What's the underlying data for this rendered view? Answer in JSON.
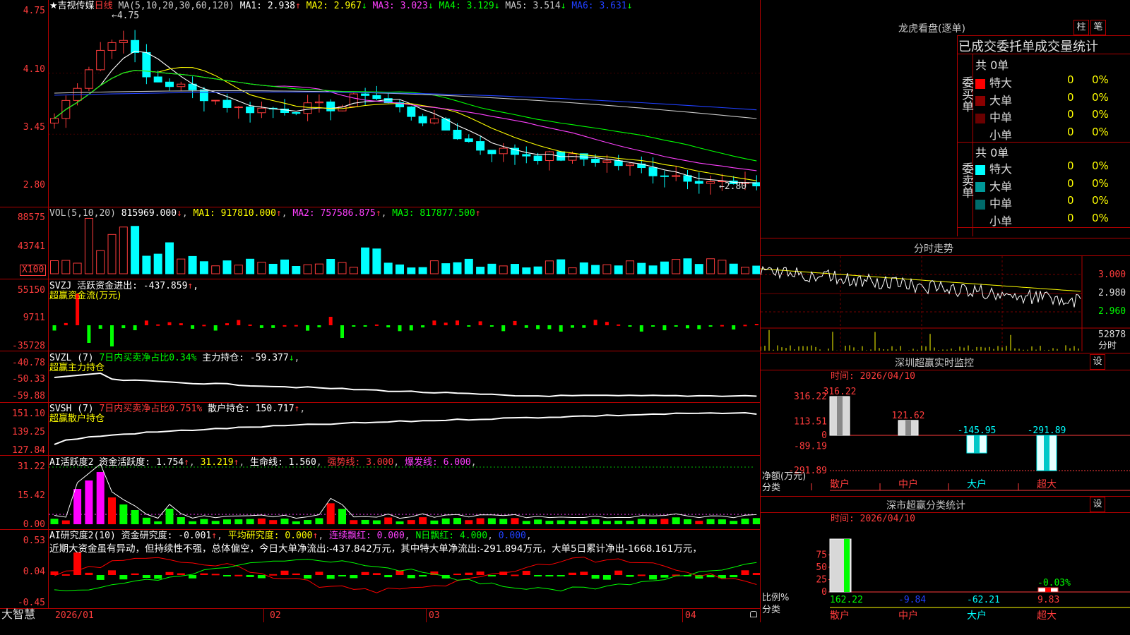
{
  "main": {
    "title": "★吉视传媒",
    "period": "日线",
    "ma_header": "MA(5,10,20,30,60,120)",
    "ma": [
      {
        "label": "MA1: 2.938",
        "arrow": "↑",
        "color": "#ffffff"
      },
      {
        "label": "MA2: 2.967",
        "arrow": "↓",
        "color": "#ffff00"
      },
      {
        "label": "MA3: 3.023",
        "arrow": "↓",
        "color": "#ff40ff"
      },
      {
        "label": "MA4: 3.129",
        "arrow": "↓",
        "color": "#00ff00"
      },
      {
        "label": "MA5: 3.514",
        "arrow": "↓",
        "color": "#c8c8c8"
      },
      {
        "label": "MA6: 3.631",
        "arrow": "↓",
        "color": "#2040ff"
      }
    ],
    "yticks": [
      "4.75",
      "4.10",
      "3.45",
      "2.80"
    ],
    "high_mark": "4.75",
    "low_mark": "2.80"
  },
  "vol": {
    "header": "VOL(5,10,20)",
    "value": "815969.000",
    "ma1": "MA1: 917810.000",
    "ma2": "MA2: 757586.875",
    "ma3": "MA3: 817877.500",
    "yticks": [
      "88575",
      "43741"
    ],
    "unit": "X100"
  },
  "svzj": {
    "header": "SVZJ  活跃资金进出: -437.859",
    "sub": "超赢资金流(万元)",
    "yticks": [
      "55150",
      "9711",
      "-35728"
    ]
  },
  "svzl": {
    "header": "SVZL (7)",
    "green": "7日内买卖净占比0.34%",
    "white": "主力持仓: -59.377",
    "sub": "超赢主力持仓",
    "yticks": [
      "-40.78",
      "-50.33",
      "-59.88"
    ]
  },
  "svsh": {
    "header": "SVSH (7)",
    "red": "7日内买卖净占比0.751%",
    "white": "散户持仓: 150.717",
    "sub": "超赢散户持仓",
    "yticks": [
      "151.10",
      "139.25",
      "127.84"
    ]
  },
  "ai1": {
    "header": "AI活跃度2 资金活跃度: 1.754",
    "v2": "31.219",
    "v3": "生命线: 1.560",
    "v4": "强势线: 3.000",
    "v5": "爆发线: 6.000",
    "yticks": [
      "31.22",
      "15.42",
      "0.00"
    ]
  },
  "ai2": {
    "header": "AI研究度2(10) 资金研究度: -0.001",
    "v2": "平均研究度: 0.000",
    "v3": "连续飘红: 0.000",
    "v4": "N日飘红: 4.000",
    "v5": "0.000",
    "comment": "近期大资金虽有异动，但持续性不强，总体偏空，今日大单净流出:-437.842万元，其中特大单净流出:-291.894万元，大单5日累计净出-1668.161万元，",
    "yticks": [
      "0.53",
      "0.04",
      "-0.45"
    ]
  },
  "xaxis": [
    "2026/01",
    "02",
    "03",
    "04"
  ],
  "brand": "大智慧",
  "longhu": {
    "title": "龙虎看盘(逐单)",
    "btn1": "柱",
    "btn2": "笔",
    "tabs": "已成交委托单成交量统计",
    "buy_label": "委买单",
    "sell_label": "委卖单",
    "buy_total": "共 0单",
    "sell_total": "共 0单",
    "buy_rows": [
      {
        "name": "特大",
        "val": "0",
        "pct": "0%",
        "color": "#ff0000"
      },
      {
        "name": "大单",
        "val": "0",
        "pct": "0%",
        "color": "#8b0000"
      },
      {
        "name": "中单",
        "val": "0",
        "pct": "0%",
        "color": "#6a0000"
      },
      {
        "name": "小单",
        "val": "0",
        "pct": "0%",
        "color": "#000000"
      }
    ],
    "sell_rows": [
      {
        "name": "特大",
        "val": "0",
        "pct": "0%",
        "color": "#00ffff"
      },
      {
        "name": "大单",
        "val": "0",
        "pct": "0%",
        "color": "#009999"
      },
      {
        "name": "中单",
        "val": "0",
        "pct": "0%",
        "color": "#006a6a"
      },
      {
        "name": "小单",
        "val": "0",
        "pct": "0%",
        "color": "#000000"
      }
    ]
  },
  "intraday": {
    "title": "分时走势",
    "prices": [
      "3.000",
      "2.980",
      "2.960"
    ],
    "vol": "52878",
    "vol_unit": "分时"
  },
  "monitor": {
    "title": "深圳超赢实时监控",
    "btn": "设",
    "time": "时间: 2026/04/10",
    "yticks": [
      "316.22",
      "113.51",
      "0",
      "-89.19",
      "-291.89"
    ],
    "ylabel": "净额(万元)",
    "xlabel": "分类",
    "cats": [
      "散户",
      "中户",
      "大户",
      "超大"
    ],
    "values": [
      "316.22",
      "121.62",
      "-145.95",
      "-291.89"
    ]
  },
  "stats": {
    "title": "深市超赢分类统计",
    "btn": "设",
    "time": "时间: 2026/04/10",
    "yticks": [
      "75",
      "50",
      "25",
      "0"
    ],
    "ylabel": "比例%",
    "xlabel": "分类",
    "cats": [
      "散户",
      "中户",
      "大户",
      "超大"
    ],
    "values": [
      "162.22",
      "-9.84",
      "-62.21",
      "9.83"
    ],
    "note": "-0.03%"
  },
  "chart_data": {
    "type": "bar",
    "title": "深圳超赢实时监控",
    "categories": [
      "散户",
      "中户",
      "大户",
      "超大"
    ],
    "values": [
      316.22,
      121.62,
      -145.95,
      -291.89
    ],
    "ylabel": "净额(万元)",
    "ylim": [
      -291.89,
      316.22
    ]
  }
}
